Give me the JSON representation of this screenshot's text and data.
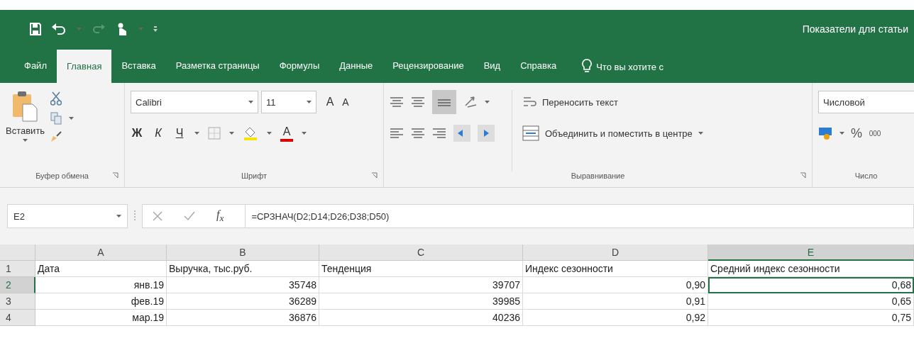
{
  "title_bar": {
    "title": "Показатели для статьи",
    "redo_disabled": true
  },
  "tabs": [
    {
      "label": "Файл",
      "selected": false
    },
    {
      "label": "Главная",
      "selected": true
    },
    {
      "label": "Вставка",
      "selected": false
    },
    {
      "label": "Разметка страницы",
      "selected": false
    },
    {
      "label": "Формулы",
      "selected": false
    },
    {
      "label": "Данные",
      "selected": false
    },
    {
      "label": "Рецензирование",
      "selected": false
    },
    {
      "label": "Вид",
      "selected": false
    },
    {
      "label": "Справка",
      "selected": false
    }
  ],
  "search_hint": "Что вы хотите с",
  "ribbon": {
    "clipboard": {
      "paste": "Вставить",
      "label": "Буфер обмена"
    },
    "font": {
      "font_name": "Calibri",
      "font_size": "11",
      "grow": "A",
      "shrink": "A",
      "bold": "Ж",
      "italic": "К",
      "underline": "Ч",
      "font_color": "A",
      "label": "Шрифт"
    },
    "alignment": {
      "wrap_text": "Переносить текст",
      "merge": "Объединить и поместить в центре",
      "label": "Выравнивание"
    },
    "number": {
      "format": "Числовой",
      "percent": "%",
      "thousands": "000",
      "label": "Число"
    }
  },
  "formula_bar": {
    "name_box": "E2",
    "fx": "f$_{x}$",
    "formula": "=СРЗНАЧ(D2;D14;D26;D38;D50)"
  },
  "sheet": {
    "columns": [
      {
        "label": "A",
        "selected": false
      },
      {
        "label": "B",
        "selected": false
      },
      {
        "label": "C",
        "selected": false
      },
      {
        "label": "D",
        "selected": false
      },
      {
        "label": "E",
        "selected": true
      }
    ],
    "rows": [
      {
        "number": "1",
        "selected": false,
        "cells": [
          {
            "text": "Дата",
            "kind": "text",
            "selected": false
          },
          {
            "text": "Выручка, тыс.руб.",
            "kind": "text",
            "selected": false
          },
          {
            "text": "Тенденция",
            "kind": "text",
            "selected": false
          },
          {
            "text": "Индекс сезонности",
            "kind": "text",
            "selected": false
          },
          {
            "text": "Средний индекс сезонности",
            "kind": "text",
            "selected": false
          }
        ]
      },
      {
        "number": "2",
        "selected": true,
        "cells": [
          {
            "text": "янв.19",
            "kind": "number",
            "selected": false
          },
          {
            "text": "35748",
            "kind": "number",
            "selected": false
          },
          {
            "text": "39707",
            "kind": "number",
            "selected": false
          },
          {
            "text": "0,90",
            "kind": "number",
            "selected": false
          },
          {
            "text": "0,68",
            "kind": "number",
            "selected": true
          }
        ]
      },
      {
        "number": "3",
        "selected": false,
        "cells": [
          {
            "text": "фев.19",
            "kind": "number",
            "selected": false
          },
          {
            "text": "36289",
            "kind": "number",
            "selected": false
          },
          {
            "text": "39985",
            "kind": "number",
            "selected": false
          },
          {
            "text": "0,91",
            "kind": "number",
            "selected": false
          },
          {
            "text": "0,65",
            "kind": "number",
            "selected": false
          }
        ]
      },
      {
        "number": "4",
        "selected": false,
        "cells": [
          {
            "text": "мар.19",
            "kind": "number",
            "selected": false
          },
          {
            "text": "36876",
            "kind": "number",
            "selected": false
          },
          {
            "text": "40236",
            "kind": "number",
            "selected": false
          },
          {
            "text": "0,92",
            "kind": "number",
            "selected": false
          },
          {
            "text": "0,75",
            "kind": "number",
            "selected": false
          }
        ]
      }
    ]
  }
}
